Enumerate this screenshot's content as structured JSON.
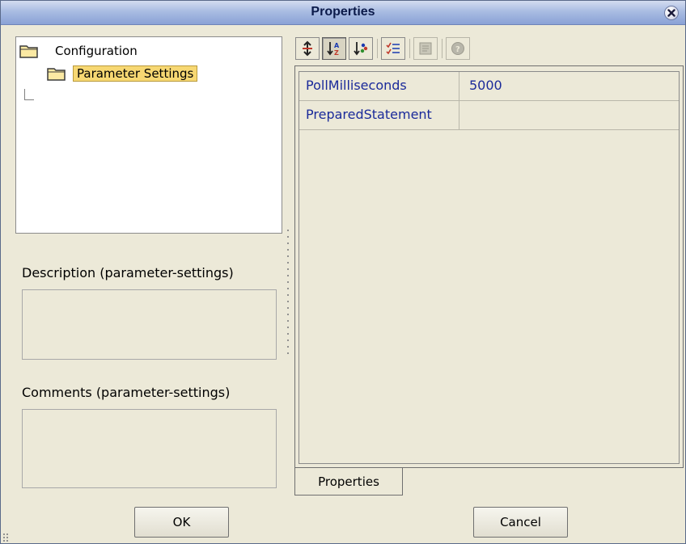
{
  "window": {
    "title": "Properties"
  },
  "tree": {
    "items": [
      {
        "label": "Configuration",
        "icon": "folder-icon",
        "selected": false
      },
      {
        "label": "Parameter Settings",
        "icon": "folder-icon",
        "selected": true
      }
    ]
  },
  "description": {
    "label": "Description (parameter-settings)",
    "value": ""
  },
  "comments": {
    "label": "Comments (parameter-settings)",
    "value": ""
  },
  "toolbar": {
    "buttons": [
      {
        "icon": "unsorted-icon"
      },
      {
        "icon": "sort-az-icon",
        "pressed": true
      },
      {
        "icon": "sort-by-category-icon"
      },
      {
        "icon": "show-changed-icon"
      },
      {
        "icon": "property-editor-icon",
        "disabled": true
      },
      {
        "icon": "help-icon",
        "disabled": true
      }
    ]
  },
  "properties": {
    "rows": [
      {
        "name": "PollMilliseconds",
        "value": "5000"
      },
      {
        "name": "PreparedStatement",
        "value": ""
      }
    ]
  },
  "tabs": {
    "properties_label": "Properties"
  },
  "buttons": {
    "ok_label": "OK",
    "cancel_label": "Cancel"
  },
  "colors": {
    "selection_highlight": "#f7d873",
    "property_text": "#1a2a9a",
    "dialog_background": "#ece9d8"
  }
}
